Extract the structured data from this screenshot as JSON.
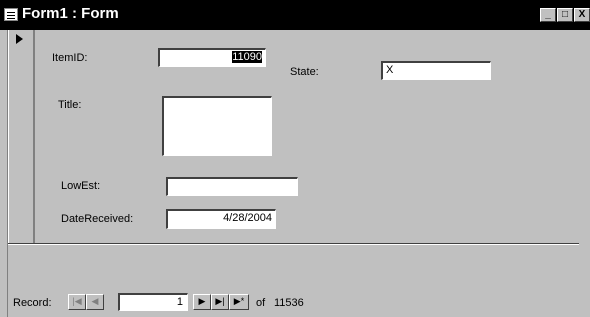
{
  "window": {
    "title": "Form1 : Form",
    "min_glyph": "_",
    "max_glyph": "□",
    "close_glyph": "X"
  },
  "form": {
    "itemid_label": "ItemID:",
    "itemid_value": "11090",
    "state_label": "State:",
    "state_value": "X",
    "title_label": "Title:",
    "title_value": "",
    "lowest_label": "LowEst:",
    "lowest_value": "",
    "datereceived_label": "DateReceived:",
    "datereceived_value": "4/28/2004"
  },
  "navigator": {
    "record_label": "Record:",
    "first_glyph": "|◀",
    "prev_glyph": "◀",
    "current_record": "1",
    "next_glyph": "▶",
    "last_glyph": "▶|",
    "new_glyph": "▶*",
    "of_label": "of",
    "total_records": "11536"
  }
}
